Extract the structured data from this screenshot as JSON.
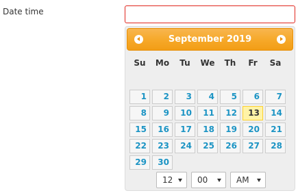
{
  "form": {
    "label": "Date time",
    "value": ""
  },
  "calendar": {
    "title": "September 2019",
    "weekdays": [
      "Su",
      "Mo",
      "Tu",
      "We",
      "Th",
      "Fr",
      "Sa"
    ],
    "weeks": [
      [
        "",
        "",
        "",
        "",
        "",
        "",
        ""
      ],
      [
        "1",
        "2",
        "3",
        "4",
        "5",
        "6",
        "7"
      ],
      [
        "8",
        "9",
        "10",
        "11",
        "12",
        "13",
        "14"
      ],
      [
        "15",
        "16",
        "17",
        "18",
        "19",
        "20",
        "21"
      ],
      [
        "22",
        "23",
        "24",
        "25",
        "26",
        "27",
        "28"
      ],
      [
        "29",
        "30",
        "",
        "",
        "",
        "",
        ""
      ]
    ],
    "highlighted_day": "13",
    "prev_icon": "chevron-left-icon",
    "next_icon": "chevron-right-icon"
  },
  "time": {
    "hour": "12",
    "minute": "00",
    "period": "AM"
  },
  "colors": {
    "header": "#f6a828",
    "day_text": "#1c94c4",
    "highlight": "#fff3a7",
    "input_border": "#e0261e"
  }
}
